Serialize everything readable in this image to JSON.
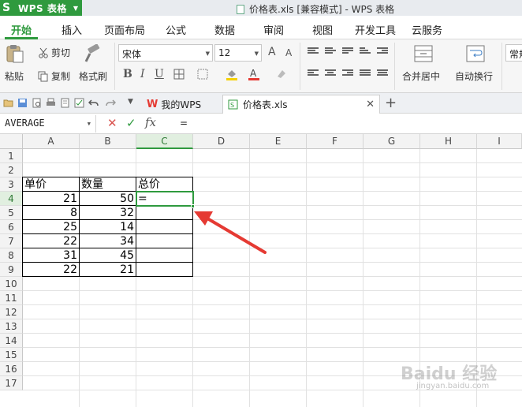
{
  "titlebar": {
    "app_logo": "S",
    "app_name": "WPS 表格",
    "document_title": "价格表.xls [兼容模式] - WPS 表格"
  },
  "menu": {
    "tabs": [
      "开始",
      "插入",
      "页面布局",
      "公式",
      "数据",
      "审阅",
      "视图",
      "开发工具",
      "云服务"
    ],
    "active": "开始"
  },
  "ribbon": {
    "paste": "粘贴",
    "cut": "剪切",
    "copy": "复制",
    "format_painter": "格式刷",
    "font_name": "宋体",
    "font_size": "12",
    "grow_font": "A",
    "shrink_font": "A",
    "bold": "B",
    "italic": "I",
    "underline": "U",
    "merge_center": "合并居中",
    "wrap_text": "自动换行",
    "number_format": "常规"
  },
  "tabs": {
    "home_tab": "我的WPS",
    "doc_tab": "价格表.xls"
  },
  "formula_bar": {
    "name_box": "AVERAGE",
    "cancel": "✕",
    "confirm": "✓",
    "fx": "fx",
    "content": "="
  },
  "sheet": {
    "columns": [
      "A",
      "B",
      "C",
      "D",
      "E",
      "F",
      "G",
      "H",
      "I"
    ],
    "rows": [
      "1",
      "2",
      "3",
      "4",
      "5",
      "6",
      "7",
      "8",
      "9",
      "10",
      "11",
      "12",
      "13",
      "14",
      "15",
      "16",
      "17"
    ],
    "active_column": "C",
    "active_row": "4",
    "headers": {
      "a3": "单价",
      "b3": "数量",
      "c3": "总价"
    },
    "data": [
      {
        "a": "21",
        "b": "50",
        "c": "="
      },
      {
        "a": "8",
        "b": "32",
        "c": ""
      },
      {
        "a": "25",
        "b": "14",
        "c": ""
      },
      {
        "a": "22",
        "b": "34",
        "c": ""
      },
      {
        "a": "31",
        "b": "45",
        "c": ""
      },
      {
        "a": "22",
        "b": "21",
        "c": ""
      }
    ]
  },
  "annotation": {
    "arrow_color": "#e53a33"
  },
  "watermark": {
    "main": "Baidu 经验",
    "sub": "jingyan.baidu.com"
  },
  "colors": {
    "accent": "#2f9a3e",
    "title_bg": "#e8ebef"
  }
}
